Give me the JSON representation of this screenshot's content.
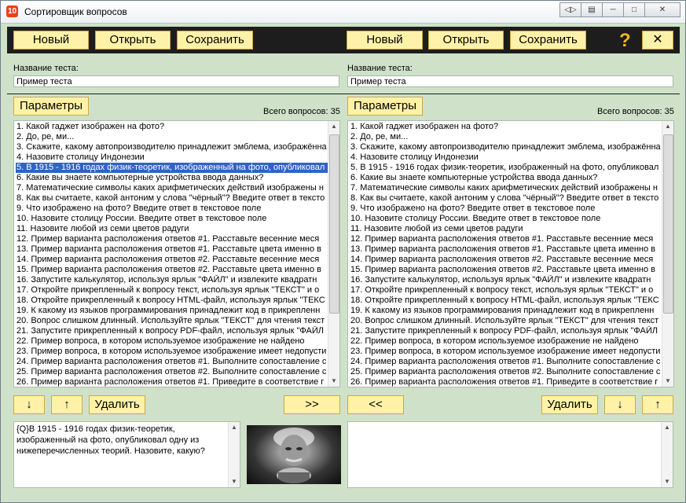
{
  "window": {
    "title": "Сортировщик вопросов",
    "app_icon_text": "10",
    "btn_help_icon": "?"
  },
  "toolbar": {
    "new": "Новый",
    "open": "Открыть",
    "save": "Сохранить",
    "close": "✕"
  },
  "left": {
    "test_name_label": "Название теста:",
    "test_name_value": "Пример теста",
    "params": "Параметры",
    "total": "Всего вопросов: 35",
    "questions": [
      "1. Какой гаджет изображен на фото?",
      "2. До, ре, ми...",
      "3. Скажите, какому автопроизводителю принадлежит эмблема, изображённа",
      "4. Назовите столицу Индонезии",
      "5. В 1915 - 1916 годах физик-теоретик, изображенный на фото, опубликовал",
      "6. Какие вы знаете компьютерные устройства ввода данных?",
      "7. Математические символы каких арифметических действий изображены н",
      "8. Как вы считаете, какой антоним у слова \"чёрный\"? Введите ответ в тексто",
      "9. Что изображено на фото? Введите ответ в текстовое поле",
      "10. Назовите столицу России. Введите ответ в текстовое поле",
      "11. Назовите любой из семи цветов радуги",
      "12. Пример варианта расположения ответов #1. Расставьте весенние меся",
      "13. Пример варианта расположения ответов #1. Расставьте цвета именно в",
      "14. Пример варианта расположения ответов #2. Расставьте весенние меся",
      "15. Пример варианта расположения ответов #2. Расставьте цвета именно в",
      "16. Запустите калькулятор, используя ярлык \"ФАЙЛ\" и извлеките квадратн",
      "17. Откройте прикрепленный к вопросу текст, используя ярлык \"ТЕКСТ\" и о",
      "18. Откройте прикрепленный к вопросу HTML-файл, используя ярлык \"ТЕКС",
      "19. К какому из языков программирования принадлежит код в прикрепленн",
      "20. Вопрос слишком длинный. Используйте ярлык \"ТЕКСТ\" для чтения текст",
      "21. Запустите прикрепленный к вопросу PDF-файл, используя ярлык \"ФАЙЛ",
      "22. Пример вопроса, в котором используемое изображение не найдено",
      "23. Пример вопроса, в котором используемое изображение имеет недопусти",
      "24. Пример варианта расположения ответов #1. Выполните сопоставление с",
      "25. Пример варианта расположения ответов #2. Выполните сопоставление с",
      "26. Пример варианта расположения ответов #1. Приведите в соответствие г"
    ],
    "selected_index": 4,
    "down": "↓",
    "up": "↑",
    "delete": "Удалить",
    "move_right": ">>",
    "preview_text": "{Q}В 1915 - 1916 годах физик-теоретик, изображенный на фото, опубликовал одну из нижеперечисленных теорий. Назовите, какую?"
  },
  "right": {
    "test_name_label": "Название теста:",
    "test_name_value": "Пример теста",
    "params": "Параметры",
    "total": "Всего вопросов: 35",
    "questions": [
      "1. Какой гаджет изображен на фото?",
      "2. До, ре, ми...",
      "3. Скажите, какому автопроизводителю принадлежит эмблема, изображённа",
      "4. Назовите столицу Индонезии",
      "5. В 1915 - 1916 годах физик-теоретик, изображенный на фото, опубликовал",
      "6. Какие вы знаете компьютерные устройства ввода данных?",
      "7. Математические символы каких арифметических действий изображены н",
      "8. Как вы считаете, какой антоним у слова \"чёрный\"? Введите ответ в тексто",
      "9. Что изображено на фото? Введите ответ в текстовое поле",
      "10. Назовите столицу России. Введите ответ в текстовое поле",
      "11. Назовите любой из семи цветов радуги",
      "12. Пример варианта расположения ответов #1. Расставьте весенние меся",
      "13. Пример варианта расположения ответов #1. Расставьте цвета именно в",
      "14. Пример варианта расположения ответов #2. Расставьте весенние меся",
      "15. Пример варианта расположения ответов #2. Расставьте цвета именно в",
      "16. Запустите калькулятор, используя ярлык \"ФАЙЛ\" и извлеките квадратн",
      "17. Откройте прикрепленный к вопросу текст, используя ярлык \"ТЕКСТ\" и о",
      "18. Откройте прикрепленный к вопросу HTML-файл, используя ярлык \"ТЕКС",
      "19. К какому из языков программирования принадлежит код в прикрепленн",
      "20. Вопрос слишком длинный. Используйте ярлык \"ТЕКСТ\" для чтения текст",
      "21. Запустите прикрепленный к вопросу PDF-файл, используя ярлык \"ФАЙЛ",
      "22. Пример вопроса, в котором используемое изображение не найдено",
      "23. Пример вопроса, в котором используемое изображение имеет недопусти",
      "24. Пример варианта расположения ответов #1. Выполните сопоставление с",
      "25. Пример варианта расположения ответов #2. Выполните сопоставление с",
      "26. Пример варианта расположения ответов #1. Приведите в соответствие г"
    ],
    "delete": "Удалить",
    "down": "↓",
    "up": "↑",
    "move_left": "<<"
  },
  "colors": {
    "button_bg": "#fff2a8",
    "toolbar_bg": "#1d1d1d",
    "window_bg": "#cfe2c9",
    "selection": "#3163c6",
    "help_icon": "#f2b61c"
  }
}
